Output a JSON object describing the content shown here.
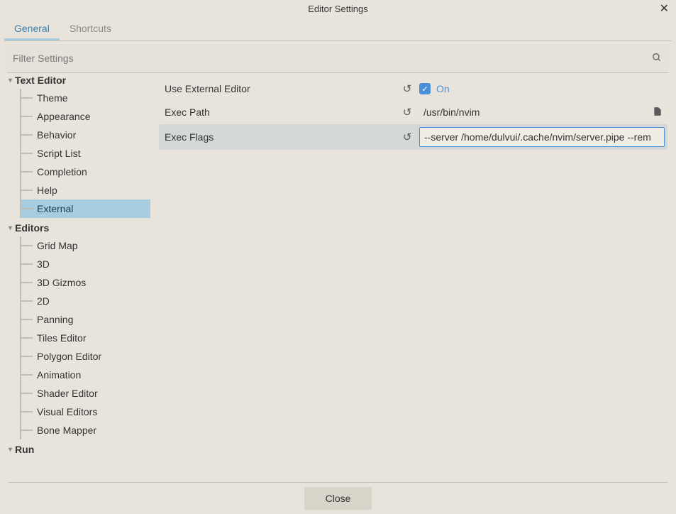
{
  "window": {
    "title": "Editor Settings"
  },
  "tabs": [
    {
      "label": "General",
      "active": true
    },
    {
      "label": "Shortcuts",
      "active": false
    }
  ],
  "filter": {
    "placeholder": "Filter Settings"
  },
  "sidebar": {
    "sections": [
      {
        "title": "Text Editor",
        "items": [
          {
            "label": "Theme"
          },
          {
            "label": "Appearance"
          },
          {
            "label": "Behavior"
          },
          {
            "label": "Script List"
          },
          {
            "label": "Completion"
          },
          {
            "label": "Help"
          },
          {
            "label": "External",
            "selected": true
          }
        ]
      },
      {
        "title": "Editors",
        "items": [
          {
            "label": "Grid Map"
          },
          {
            "label": "3D"
          },
          {
            "label": "3D Gizmos"
          },
          {
            "label": "2D"
          },
          {
            "label": "Panning"
          },
          {
            "label": "Tiles Editor"
          },
          {
            "label": "Polygon Editor"
          },
          {
            "label": "Animation"
          },
          {
            "label": "Shader Editor"
          },
          {
            "label": "Visual Editors"
          },
          {
            "label": "Bone Mapper"
          }
        ]
      },
      {
        "title": "Run",
        "items": []
      }
    ]
  },
  "settings": {
    "use_external_editor": {
      "label": "Use External Editor",
      "value": true,
      "on_label": "On"
    },
    "exec_path": {
      "label": "Exec Path",
      "value": "/usr/bin/nvim"
    },
    "exec_flags": {
      "label": "Exec Flags",
      "value": "--server /home/dulvui/.cache/nvim/server.pipe --rem"
    }
  },
  "footer": {
    "close_label": "Close"
  }
}
